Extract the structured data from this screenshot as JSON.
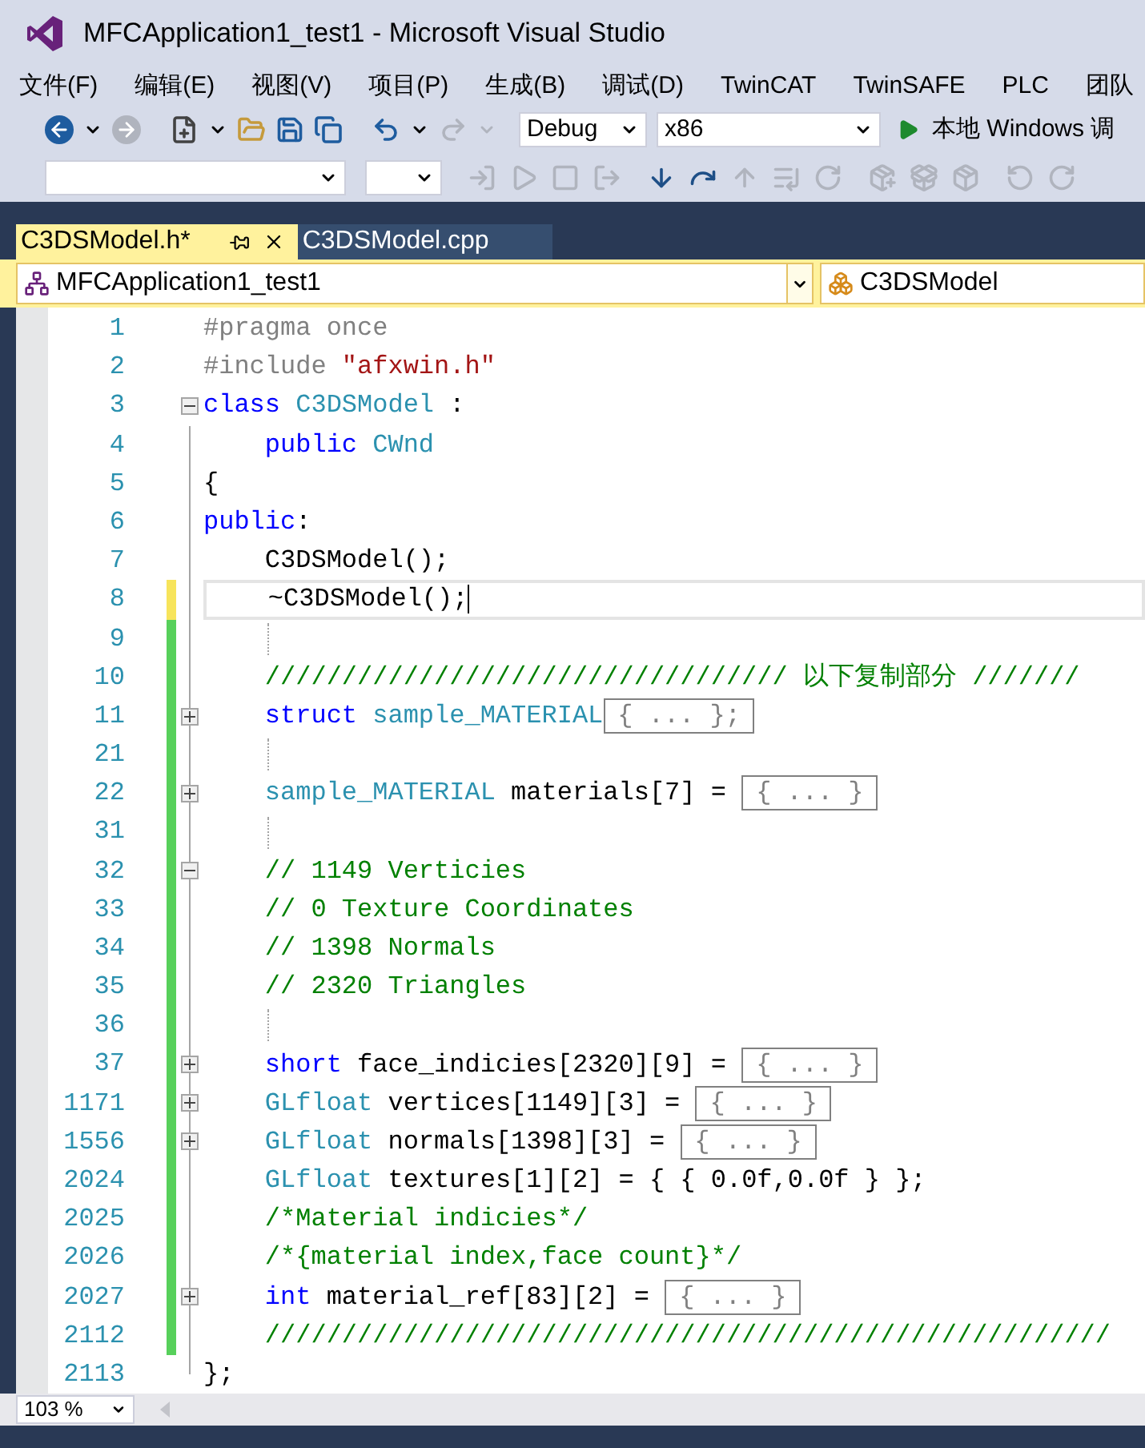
{
  "window": {
    "title": "MFCApplication1_test1 - Microsoft Visual Studio"
  },
  "menu": [
    "文件(F)",
    "编辑(E)",
    "视图(V)",
    "项目(P)",
    "生成(B)",
    "调试(D)",
    "TwinCAT",
    "TwinSAFE",
    "PLC",
    "团队"
  ],
  "toolbar": {
    "configuration": "Debug",
    "platform": "x86",
    "run_label": "本地 Windows 调"
  },
  "tabs": [
    {
      "label": "C3DSModel.h*",
      "selected": true
    },
    {
      "label": "C3DSModel.cpp",
      "selected": false
    }
  ],
  "navigation": {
    "project": "MFCApplication1_test1",
    "scope": "C3DSModel"
  },
  "lines": [
    {
      "number": "1",
      "current": false,
      "tokens": [
        {
          "kind": "preproc",
          "text": "#pragma once"
        }
      ]
    },
    {
      "number": "2",
      "current": false,
      "tokens": [
        {
          "kind": "preproc",
          "text": "#include "
        },
        {
          "kind": "string",
          "text": "\"afxwin.h\""
        }
      ]
    },
    {
      "number": "3",
      "expanded": true,
      "current": false,
      "tokens": [
        {
          "kind": "keyword",
          "text": "class"
        },
        {
          "kind": "type",
          "text": " C3DSModel"
        },
        {
          "kind": "plain",
          "text": " :"
        }
      ]
    },
    {
      "number": "4",
      "current": false,
      "tokens": [
        {
          "kind": "keyword",
          "text": "    public"
        },
        {
          "kind": "type",
          "text": " CWnd"
        }
      ]
    },
    {
      "number": "5",
      "current": false,
      "tokens": [
        {
          "kind": "plain",
          "text": "{"
        }
      ]
    },
    {
      "number": "6",
      "current": false,
      "tokens": [
        {
          "kind": "keyword",
          "text": "public"
        },
        {
          "kind": "plain",
          "text": ":"
        }
      ]
    },
    {
      "number": "7",
      "current": false,
      "tokens": [
        {
          "kind": "plain",
          "text": "    C3DSModel();"
        }
      ]
    },
    {
      "number": "8",
      "color": "#f7e45b",
      "current": true,
      "tokens": [
        {
          "kind": "plain",
          "text": "    ~C3DSModel();"
        }
      ]
    },
    {
      "number": "9",
      "color": "#57d05b",
      "current": false
    },
    {
      "number": "10",
      "color": "#57d05b",
      "current": false,
      "tokens": [
        {
          "kind": "comment",
          "text": "    ////////////////////////////////// 以下复制部分 ///////"
        }
      ]
    },
    {
      "number": "11",
      "color": "#57d05b",
      "expanded": false,
      "current": false,
      "tokens": [
        {
          "kind": "keyword",
          "text": "    struct"
        },
        {
          "kind": "type",
          "text": " sample_MATERIAL"
        }
      ],
      "collapsed": "{ ... };"
    },
    {
      "number": "21",
      "color": "#57d05b",
      "current": false
    },
    {
      "number": "22",
      "color": "#57d05b",
      "expanded": false,
      "current": false,
      "tokens": [
        {
          "kind": "type",
          "text": "    sample_MATERIAL"
        },
        {
          "kind": "plain",
          "text": " materials[7] = "
        }
      ],
      "collapsed": "{ ... }"
    },
    {
      "number": "31",
      "color": "#57d05b",
      "current": false
    },
    {
      "number": "32",
      "color": "#57d05b",
      "expanded": true,
      "current": false,
      "tokens": [
        {
          "kind": "comment",
          "text": "    // 1149 Verticies"
        }
      ]
    },
    {
      "number": "33",
      "color": "#57d05b",
      "current": false,
      "tokens": [
        {
          "kind": "comment",
          "text": "    // 0 Texture Coordinates"
        }
      ]
    },
    {
      "number": "34",
      "color": "#57d05b",
      "current": false,
      "tokens": [
        {
          "kind": "comment",
          "text": "    // 1398 Normals"
        }
      ]
    },
    {
      "number": "35",
      "color": "#57d05b",
      "current": false,
      "tokens": [
        {
          "kind": "comment",
          "text": "    // 2320 Triangles"
        }
      ]
    },
    {
      "number": "36",
      "color": "#57d05b",
      "current": false
    },
    {
      "number": "37",
      "color": "#57d05b",
      "expanded": false,
      "current": false,
      "tokens": [
        {
          "kind": "keyword",
          "text": "    short"
        },
        {
          "kind": "plain",
          "text": " face_indicies[2320][9] = "
        }
      ],
      "collapsed": "{ ... }"
    },
    {
      "number": "1171",
      "color": "#57d05b",
      "expanded": false,
      "current": false,
      "tokens": [
        {
          "kind": "type",
          "text": "    GLfloat"
        },
        {
          "kind": "plain",
          "text": " vertices[1149][3] = "
        }
      ],
      "collapsed": "{ ... }"
    },
    {
      "number": "1556",
      "color": "#57d05b",
      "expanded": false,
      "current": false,
      "tokens": [
        {
          "kind": "type",
          "text": "    GLfloat"
        },
        {
          "kind": "plain",
          "text": " normals[1398][3] = "
        }
      ],
      "collapsed": "{ ... }"
    },
    {
      "number": "2024",
      "color": "#57d05b",
      "current": false,
      "tokens": [
        {
          "kind": "type",
          "text": "    GLfloat"
        },
        {
          "kind": "plain",
          "text": " textures[1][2] = { { 0.0f,0.0f } };"
        }
      ]
    },
    {
      "number": "2025",
      "color": "#57d05b",
      "current": false,
      "tokens": [
        {
          "kind": "comment",
          "text": "    /*Material indicies*/"
        }
      ]
    },
    {
      "number": "2026",
      "color": "#57d05b",
      "current": false,
      "tokens": [
        {
          "kind": "comment",
          "text": "    /*{material index,face count}*/"
        }
      ]
    },
    {
      "number": "2027",
      "color": "#57d05b",
      "expanded": false,
      "current": false,
      "tokens": [
        {
          "kind": "keyword",
          "text": "    int"
        },
        {
          "kind": "plain",
          "text": " material_ref[83][2] = "
        }
      ],
      "collapsed": "{ ... }"
    },
    {
      "number": "2112",
      "color": "#57d05b",
      "current": false,
      "tokens": [
        {
          "kind": "comment",
          "text": "    ///////////////////////////////////////////////////////"
        }
      ]
    },
    {
      "number": "2113",
      "current": false,
      "tokens": [
        {
          "kind": "plain",
          "text": "};"
        }
      ]
    }
  ],
  "zoom": "103 %"
}
